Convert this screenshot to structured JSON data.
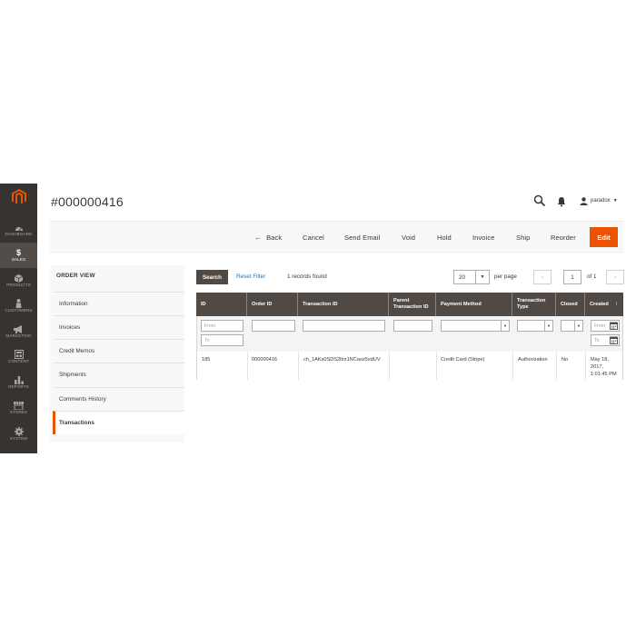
{
  "sidebar": {
    "items": [
      {
        "label": "DASHBOARD",
        "icon": "dashboard-icon"
      },
      {
        "label": "SALES",
        "icon": "dollar-icon"
      },
      {
        "label": "PRODUCTS",
        "icon": "cube-icon"
      },
      {
        "label": "CUSTOMERS",
        "icon": "person-icon"
      },
      {
        "label": "MARKETING",
        "icon": "megaphone-icon"
      },
      {
        "label": "CONTENT",
        "icon": "layout-icon"
      },
      {
        "label": "REPORTS",
        "icon": "bar-chart-icon"
      },
      {
        "label": "STORES",
        "icon": "store-icon"
      },
      {
        "label": "SYSTEM",
        "icon": "gear-icon"
      }
    ],
    "active_index": 1
  },
  "header": {
    "title": "#000000416",
    "user": "paradox"
  },
  "actions": {
    "back": "Back",
    "cancel": "Cancel",
    "send_email": "Send Email",
    "void": "Void",
    "hold": "Hold",
    "invoice": "Invoice",
    "ship": "Ship",
    "reorder": "Reorder",
    "edit": "Edit"
  },
  "order_view": {
    "title": "ORDER VIEW",
    "items": [
      "Information",
      "Invoices",
      "Credit Memos",
      "Shipments",
      "Comments History",
      "Transactions"
    ],
    "active": "Transactions"
  },
  "grid_toolbar": {
    "search": "Search",
    "reset": "Reset Filter",
    "records": "1 records found",
    "per_page_value": "20",
    "per_page_label": "per page",
    "page": "1",
    "page_total": "of 1"
  },
  "grid": {
    "columns": [
      "ID",
      "Order ID",
      "Transaction ID",
      "Parent Transaction ID",
      "Payment Method",
      "Transaction Type",
      "Closed",
      "Created"
    ],
    "filters": {
      "from": "From",
      "to": "To"
    },
    "rows": [
      {
        "id": "185",
        "order_id": "000000416",
        "transaction_id": "ch_1AKs0SDS2ltrz1NCaoz5xdUV",
        "parent_transaction_id": "",
        "payment_method": "Credit Card (Stripe)",
        "transaction_type": "Authorization",
        "closed": "No",
        "created": [
          "May 18,",
          "2017,",
          "1:01:45 PM"
        ]
      }
    ]
  },
  "colors": {
    "accent": "#eb5202",
    "sidebar": "#373330",
    "grid_header": "#514943",
    "link": "#007bdb"
  }
}
